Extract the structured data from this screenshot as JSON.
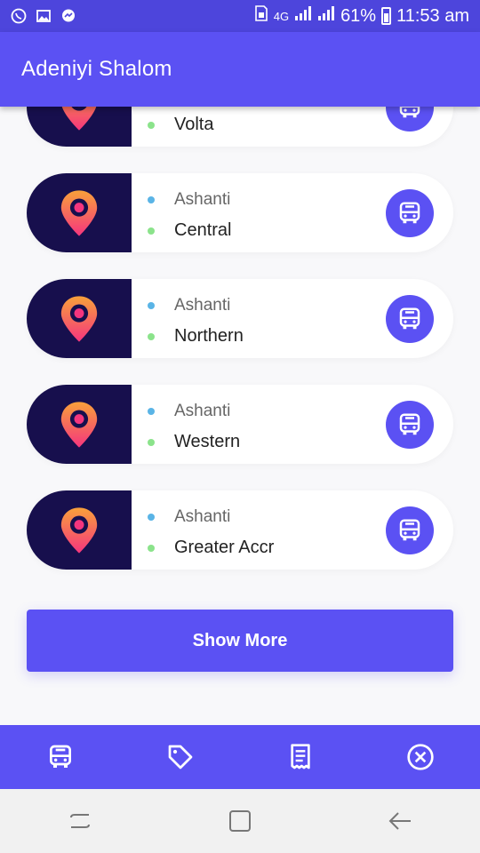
{
  "status_bar": {
    "icons": [
      "whatsapp-icon",
      "image-icon",
      "messenger-icon"
    ],
    "sim_icon": "sim-icon",
    "network": "4G",
    "battery": "61%",
    "time": "11:53 am"
  },
  "app_bar": {
    "title": "Adeniyi Shalom"
  },
  "list": {
    "items": [
      {
        "region": "",
        "city": "Volta"
      },
      {
        "region": "Ashanti",
        "city": "Central"
      },
      {
        "region": "Ashanti",
        "city": "Northern"
      },
      {
        "region": "Ashanti",
        "city": "Western"
      },
      {
        "region": "Ashanti",
        "city": "Greater Accr"
      }
    ]
  },
  "show_more_label": "Show More",
  "bottom_nav": {
    "icons": [
      "bus-icon",
      "tag-icon",
      "receipt-icon",
      "close-circle-icon"
    ]
  },
  "system_nav": {
    "icons": [
      "recents-icon",
      "home-icon",
      "back-icon"
    ]
  },
  "colors": {
    "primary": "#5b51f3",
    "status_bar": "#4d45dc",
    "icon_bg": "#170f4d",
    "pin_top": "#f8a13a",
    "pin_bottom": "#f5357e",
    "dot_blue": "#5ab4e6",
    "dot_green": "#8be38b"
  }
}
